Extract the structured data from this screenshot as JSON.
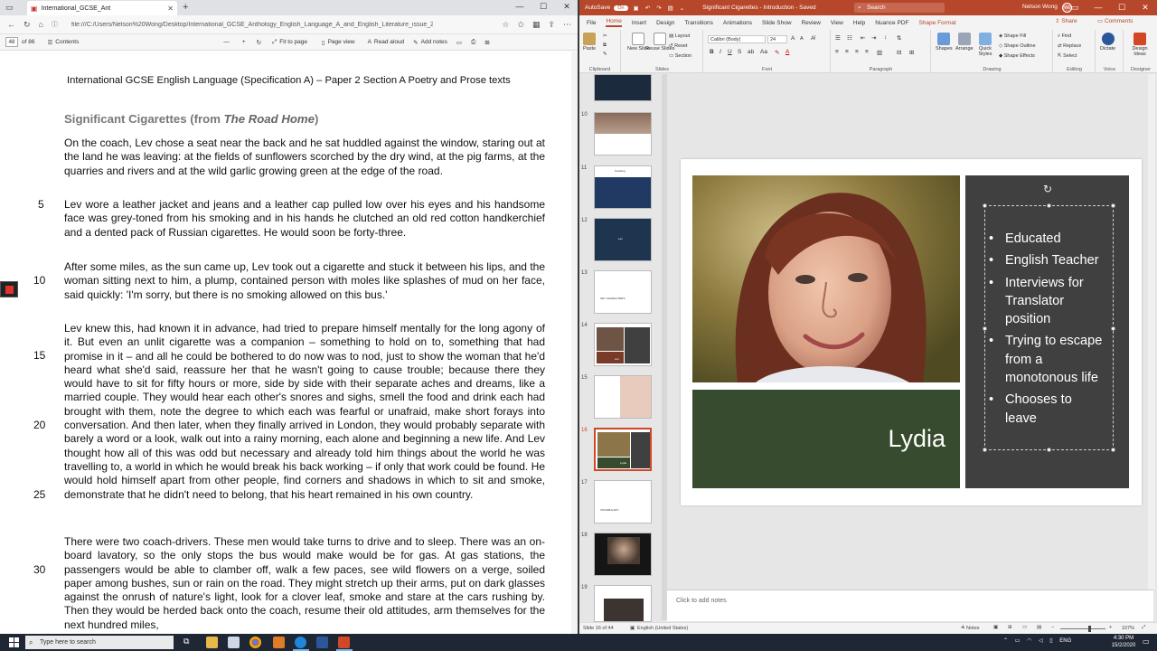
{
  "edge": {
    "tab_title": "International_GCSE_Ant",
    "url": "file:///C:/Users/Nelson%20Wong/Desktop/International_GCSE_Anthology_English_Language_A_and_English_Literature_issue_2.pdf",
    "page_current": "48",
    "page_total": "of 86",
    "toolbar": {
      "contents": "Contents",
      "fit_to_page": "Fit to page",
      "page_view": "Page view",
      "read_aloud": "Read aloud",
      "add_notes": "Add notes"
    }
  },
  "pdf": {
    "header": "International GCSE English Language (Specification A) – Paper 2 Section A Poetry and Prose texts",
    "title_prefix": "Significant Cigarettes (from ",
    "title_book": "The Road Home",
    "title_suffix": ")",
    "paragraphs": [
      "On the coach, Lev chose a seat near the back and he sat huddled against the window, staring out at the land he was leaving: at the fields of sunflowers scorched by the dry wind, at the pig farms, at the quarries and rivers and at the wild garlic growing green at the edge of the road.",
      "Lev wore a leather jacket and jeans and a leather cap pulled low over his eyes and his handsome face was grey-toned from his smoking and in his hands he clutched an old red cotton handkerchief and a dented pack of Russian cigarettes. He would soon be forty-three.",
      "After some miles, as the sun came up, Lev took out a cigarette and stuck it between his lips, and the woman sitting next to him, a plump, contained person with moles like splashes of mud on her face, said quickly: 'I'm sorry, but there is no smoking allowed on this bus.'",
      "Lev knew this, had known it in advance, had tried to prepare himself mentally for the long agony of it. But even an unlit cigarette was a companion – something to hold on to, something that had promise in it – and all he could be bothered to do now was to nod, just to show the woman that he'd heard what she'd said, reassure her that he wasn't going to cause trouble; because there they would have to sit for fifty hours or more, side by side with their separate aches and dreams, like a married couple. They would hear each other's snores and sighs, smell the food and drink each had brought with them, note the degree to which each was fearful or unafraid, make short forays into conversation. And then later, when they finally arrived in London, they would probably separate with barely a word or a look, walk out into a rainy morning, each alone and beginning a new life. And Lev thought how all of this was odd but necessary and already told him things about the world he was travelling to, a world in which he would break his back working – if only that work could be found. He would hold himself apart from other people, find corners and shadows in which to sit and smoke, demonstrate that he didn't need to belong, that his heart remained in his own country.",
      "There were two coach-drivers. These men would take turns to drive and to sleep. There was an on-board lavatory, so the only stops the bus would make would be for gas. At gas stations, the passengers would be able to clamber off, walk a few paces, see wild flowers on a verge, soiled paper among bushes, sun or rain on the road. They might stretch up their arms, put on dark glasses against the onrush of nature's light, look for a clover leaf, smoke and stare at the cars rushing by. Then they would be herded back onto the coach, resume their old attitudes, arm themselves for the next hundred miles,"
    ],
    "line_numbers": [
      "5",
      "10",
      "15",
      "20",
      "25",
      "30"
    ]
  },
  "ppt": {
    "autosave": "AutoSave",
    "autosave_state": "On",
    "doc_title": "Significant Cigarettes - Introduction - Saved",
    "search": "Search",
    "user": "Nelson Wong",
    "user_initials": "NW",
    "menu": [
      "File",
      "Home",
      "Insert",
      "Design",
      "Transitions",
      "Animations",
      "Slide Show",
      "Review",
      "View",
      "Help",
      "Nuance PDF",
      "Shape Format"
    ],
    "share": "Share",
    "comments": "Comments",
    "ribbon": {
      "paste": "Paste",
      "clipboard": "Clipboard",
      "new_slide": "New Slide",
      "reuse_slides": "Reuse Slides",
      "layout": "Layout",
      "reset": "Reset",
      "section": "Section",
      "slides": "Slides",
      "font_name": "Calibri (Body)",
      "font_size": "24",
      "font": "Font",
      "paragraph": "Paragraph",
      "shapes": "Shapes",
      "arrange": "Arrange",
      "quick_styles": "Quick Styles",
      "shape_fill": "Shape Fill",
      "shape_outline": "Shape Outline",
      "shape_effects": "Shape Effects",
      "drawing": "Drawing",
      "find": "Find",
      "replace": "Replace",
      "select": "Select",
      "editing": "Editing",
      "dictate": "Dictate",
      "voice": "Voice",
      "design_ideas": "Design Ideas",
      "designer": "Designer"
    },
    "thumb_numbers": [
      "10",
      "11",
      "12",
      "13",
      "14",
      "15",
      "16",
      "17",
      "18",
      "19"
    ],
    "thumb_texts": {
      "t13": "KEY CHARACTERS",
      "t17": "VOCABULARY",
      "t16_name": "Lydia",
      "t11": "Smoking",
      "t12": "Lev",
      "t14": "Lev"
    },
    "slide": {
      "name": "Lydia",
      "bullets": [
        "Educated",
        "English Teacher",
        "Interviews for Translator position",
        "Trying to escape from a monotonous life",
        "Chooses to leave"
      ]
    },
    "notes_placeholder": "Click to add notes",
    "status": {
      "slide_of": "Slide 16 of 44",
      "language": "English (United States)",
      "notes": "Notes",
      "zoom": "107%"
    }
  },
  "taskbar": {
    "search": "Type here to search",
    "tray_lang": "ENG",
    "time": "4:30 PM",
    "date": "15/2/2020"
  }
}
